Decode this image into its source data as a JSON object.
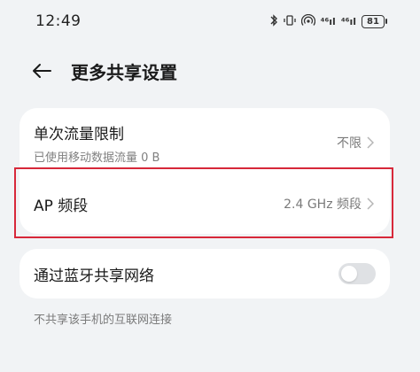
{
  "status_bar": {
    "time": "12:49",
    "icons": [
      "bluetooth-icon",
      "vibrate-icon",
      "hotspot-icon",
      "signal-icon",
      "signal-icon"
    ],
    "signal_1": "⁴⁶ıl",
    "signal_2": "⁴⁶ıl",
    "battery": "81"
  },
  "header": {
    "title": "更多共享设置"
  },
  "settings": {
    "data_limit": {
      "title": "单次流量限制",
      "subtitle": "已使用移动数据流量 0 B",
      "value": "不限"
    },
    "ap_band": {
      "title": "AP 频段",
      "value": "2.4 GHz 频段"
    },
    "bluetooth_share": {
      "title": "通过蓝牙共享网络",
      "enabled": false
    }
  },
  "footnote": "不共享该手机的互联网连接",
  "colors": {
    "background": "#f1f3f5",
    "card": "#ffffff",
    "highlight": "#d7283a",
    "toggle_off": "#dfe1e4"
  }
}
